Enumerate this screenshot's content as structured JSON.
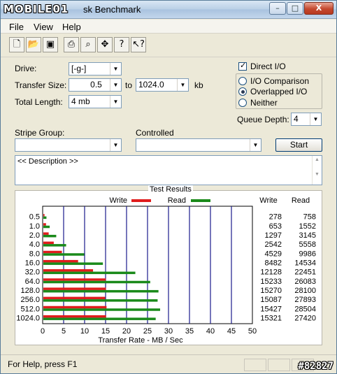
{
  "window": {
    "logo_text": "MOBILE01",
    "title": "sk Benchmark",
    "minimize": "–",
    "maximize": "□",
    "close": "X"
  },
  "menu": {
    "file": "File",
    "view": "View",
    "help": "Help"
  },
  "toolbar": {
    "icons": [
      "new-icon",
      "open-icon",
      "save-icon",
      "print-icon",
      "print-preview-icon",
      "move-icon",
      "help-icon",
      "context-help-icon"
    ]
  },
  "form": {
    "drive_label": "Drive:",
    "drive_value": "[-g-]",
    "transfer_size_label": "Transfer Size:",
    "transfer_from": "0.5",
    "transfer_to_label": "to",
    "transfer_to": "1024.0",
    "transfer_unit": "kb",
    "total_length_label": "Total Length:",
    "total_length_value": "4 mb",
    "stripe_group_label": "Stripe Group:",
    "stripe_group_value": "",
    "controlled_label": "Controlled",
    "controlled_value": "",
    "start_button": "Start",
    "description": "<< Description >>"
  },
  "options": {
    "direct_io_label": "Direct I/O",
    "direct_io_checked": true,
    "io_comparison_label": "I/O Comparison",
    "overlapped_io_label": "Overlapped I/O",
    "neither_label": "Neither",
    "selected_mode": "Overlapped I/O",
    "queue_depth_label": "Queue Depth:",
    "queue_depth_value": "4"
  },
  "results": {
    "title": "Test Results",
    "legend_write": "Write",
    "legend_read": "Read",
    "col_write": "Write",
    "col_read": "Read",
    "write_color": "#e01c1c",
    "read_color": "#1a8a1a"
  },
  "chart_data": {
    "type": "bar",
    "orientation": "horizontal",
    "categories": [
      "0.5",
      "1.0",
      "2.0",
      "4.0",
      "8.0",
      "16.0",
      "32.0",
      "64.0",
      "128.0",
      "256.0",
      "512.0",
      "1024.0"
    ],
    "series": [
      {
        "name": "Write",
        "values": [
          278,
          653,
          1297,
          2542,
          4529,
          8482,
          12128,
          15233,
          15270,
          15087,
          15427,
          15321
        ]
      },
      {
        "name": "Read",
        "values": [
          758,
          1552,
          3145,
          5558,
          9986,
          14534,
          22451,
          26083,
          28100,
          27893,
          28504,
          27420
        ]
      }
    ],
    "xlabel": "Transfer Rate - MB / Sec",
    "xticks": [
      "0",
      "5",
      "10",
      "15",
      "20",
      "25",
      "30",
      "35",
      "40",
      "45",
      "50"
    ],
    "xlim": [
      0,
      50
    ],
    "grid": true,
    "legend": "top"
  },
  "status": {
    "text": "For Help, press F1",
    "watermark": "#82827"
  }
}
